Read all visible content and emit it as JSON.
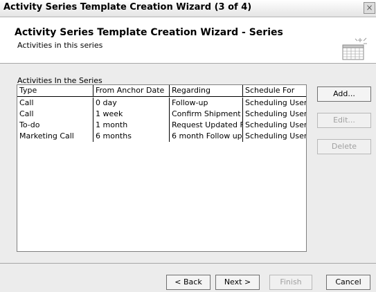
{
  "window": {
    "title": "Activity Series Template Creation Wizard (3 of 4)",
    "close_glyph": "×"
  },
  "header": {
    "title": "Activity Series Template Creation Wizard - Series",
    "subtitle": "Activities in this series",
    "icon": "calendar-icon"
  },
  "series": {
    "label": "Activities In the Series",
    "columns": [
      "Type",
      "From Anchor Date",
      "Regarding",
      "Schedule For"
    ],
    "rows": [
      [
        "Call",
        "0 day",
        "Follow-up",
        "Scheduling User"
      ],
      [
        "Call",
        "1 week",
        "Confirm Shipment",
        "Scheduling User"
      ],
      [
        "To-do",
        "1 month",
        "Request Updated F",
        "Scheduling User"
      ],
      [
        "Marketing Call",
        "6 months",
        "6 month Follow up",
        "Scheduling User"
      ]
    ]
  },
  "side_buttons": {
    "add": "Add...",
    "edit": "Edit...",
    "delete": "Delete"
  },
  "footer_buttons": {
    "back": "< Back",
    "next": "Next >",
    "finish": "Finish",
    "cancel": "Cancel"
  }
}
